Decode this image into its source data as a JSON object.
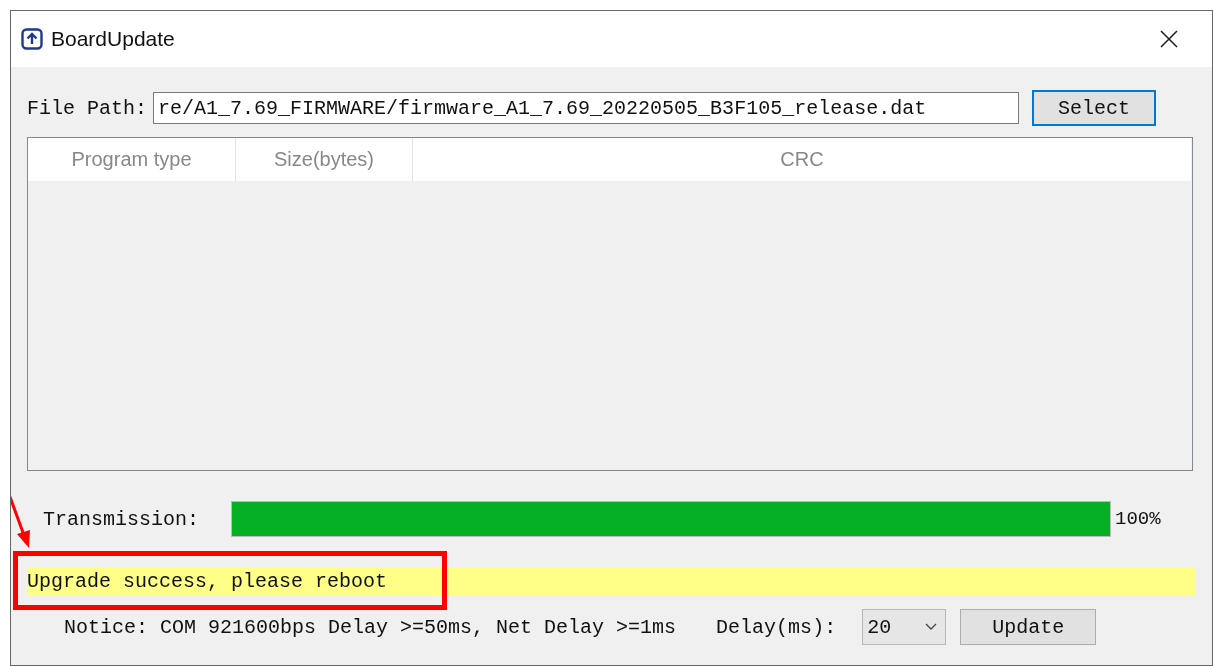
{
  "window": {
    "title": "BoardUpdate"
  },
  "file_path": {
    "label": "File Path:",
    "value": "re/A1_7.69_FIRMWARE/firmware_A1_7.69_20220505_B3F105_release.dat",
    "button": {
      "label": "Select",
      "focused": true
    }
  },
  "table": {
    "columns": [
      "Program type",
      "Size(bytes)",
      "CRC"
    ]
  },
  "progress": {
    "label": "Transmission:",
    "level": 1,
    "reading": "100%"
  },
  "status": {
    "text": "Upgrade success, please reboot"
  },
  "footer": {
    "notice": "Notice: COM 921600bps Delay >=50ms, Net Delay >=1ms",
    "delay_label": "Delay(ms):",
    "delay_value": "20",
    "button": "Update"
  }
}
